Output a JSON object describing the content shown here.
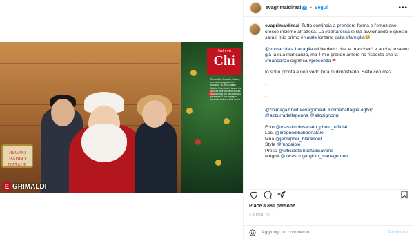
{
  "post": {
    "username": "evagrimaldireal",
    "follow_label": "Segui",
    "more_label": "•••"
  },
  "photo": {
    "sign_line1": "REGNO",
    "sign_line2": "BABBO",
    "sign_line3": "NATALE",
    "chi_small": "Solo su",
    "chi_big": "Chi",
    "chi_text": "Roma. Eva Grimaldi, 60 anni, con la compagna Imma Battaglia, 62, e un Babbo Natale. Una storia d'amore che dura da oltre vent'anni e ora il Natale porta con sé una nuova promessa. Il loro impegno contro la violenza sulle donne",
    "brand_chip": "E",
    "brand_text": "GRIMALDI"
  },
  "caption": {
    "username": "evagrimaldireal",
    "p1_a": "Tutto comincia a prendere forma e l'emozione cresce insieme all'attesa. La ",
    "p1_tag1": "#portarossa",
    "p1_b": " si sta avvicinando e questo sarà il mio primo ",
    "p1_tag2": "#Natale",
    "p1_c": " lontano dalla ",
    "p1_tag3": "#famiglia",
    "p1_emoji": "🥹",
    "p2_mention": "@immacolata.battaglia",
    "p2_a": " mi ha detto che le mancherò e anche io sento già la sua mancanza, ma il mio grande amore ho risposto che la ",
    "p2_tag1": "#mancanza",
    "p2_b": " significa ",
    "p2_tag2": "#presenza",
    "p2_heart": "❤",
    "p3": "Io sono pronta e non vedo l'ora di dimostrarlo. Siete con me?",
    "dots": [
      ".",
      ".",
      ".",
      "."
    ],
    "tags_line1_a": "@chimagazineit",
    "tags_line1_b": "#evagrimaldi",
    "tags_line1_c": "#immabattaglia",
    "tags_line1_d": "#gfvip",
    "tags_line2_a": "@azzurradellapenna",
    "tags_line2_b": "@alfosignorini",
    "credit1_label": "Foto ",
    "credit1_val": "@massimoinsabato_photo_official",
    "credit2_label": "Loc. ",
    "credit2_val": "@ilregnodibabbonatale",
    "credit3_label": "Mua ",
    "credit3_val": "@jennipher_blacksoul",
    "credit4_label": "Style ",
    "credit4_val": "@modaiole",
    "credit5_label": "Press ",
    "credit5_val": "@ufficiostampafabisavona",
    "credit6_label": "Mngmt ",
    "credit6_val": "@locasciogargiulo_management"
  },
  "stats": {
    "likes": "Piace a 881 persone",
    "date": "2 GIORNI FA"
  },
  "comment": {
    "placeholder": "Aggiungi un commento...",
    "publish": "Pubblica"
  }
}
